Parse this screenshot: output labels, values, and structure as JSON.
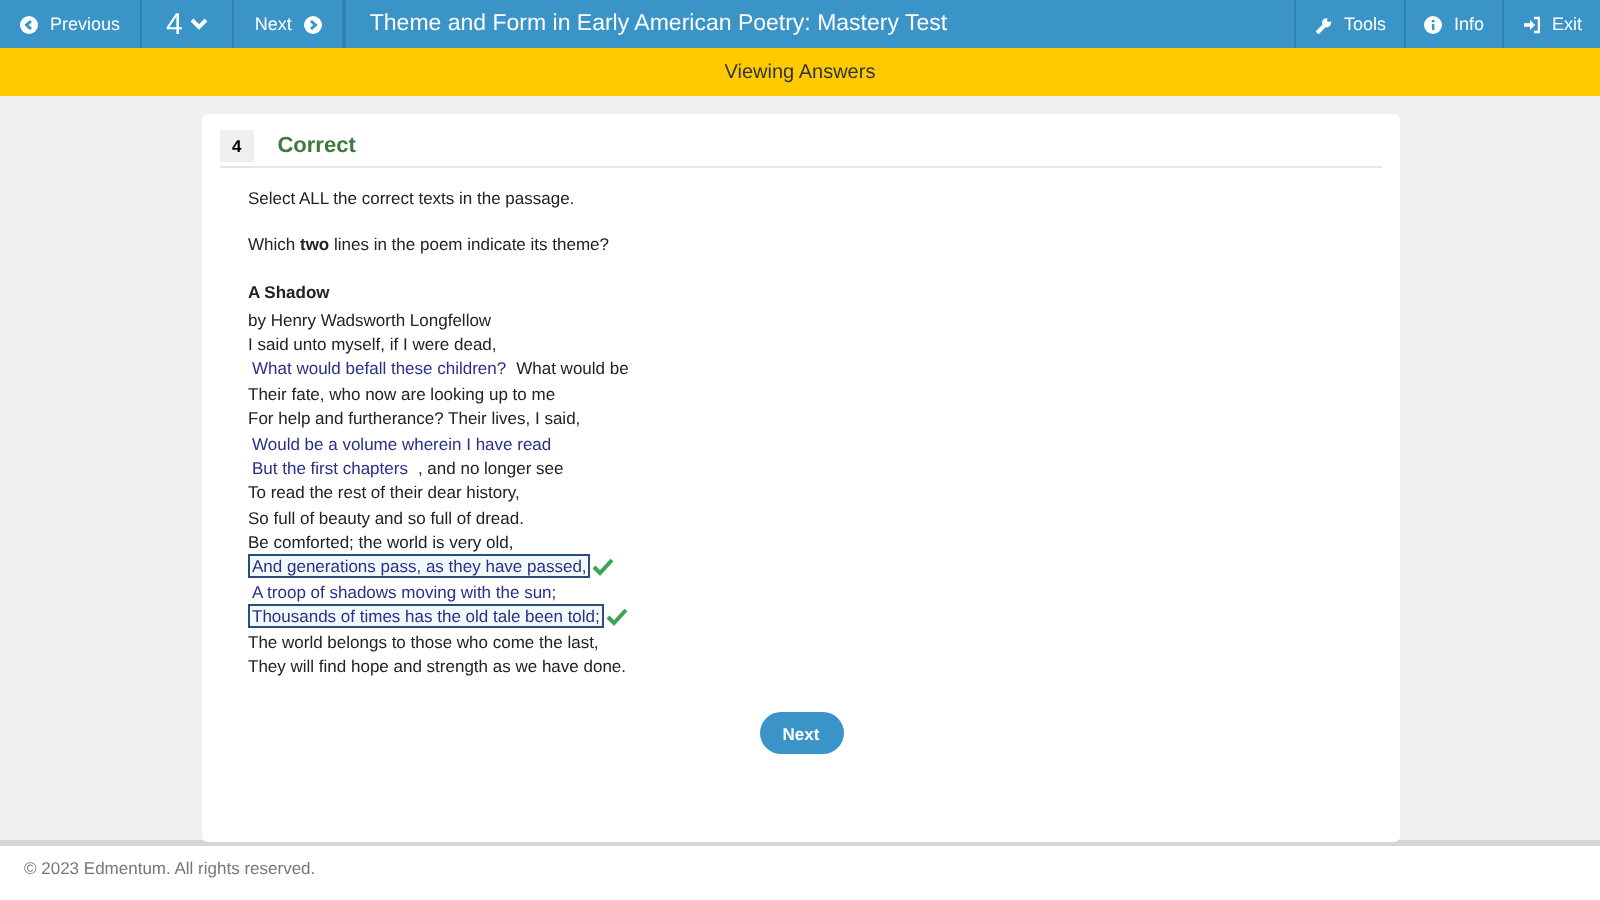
{
  "nav": {
    "previous": "Previous",
    "question_number": "4",
    "next": "Next",
    "title": "Theme and Form in Early American Poetry: Mastery Test",
    "tools": [
      {
        "kind": "tools",
        "label": "Tools"
      },
      {
        "kind": "info",
        "label": "Info"
      },
      {
        "kind": "exit",
        "label": "Exit"
      }
    ]
  },
  "banner": "Viewing Answers",
  "question": {
    "number": "4",
    "status": "Correct",
    "instruction": "Select ALL the correct texts in the passage.",
    "prompt": "Which **two** lines in the poem indicate its theme?",
    "poem_title": "A Shadow",
    "author": "by Henry Wadsworth Longfellow",
    "lines": [
      {
        "segments": [
          {
            "kind": "plain",
            "text": "I said unto myself, if I were dead,"
          }
        ]
      },
      {
        "segments": [
          {
            "kind": "option",
            "text": "What would befall these children?",
            "selected": false,
            "correct": false
          },
          {
            "kind": "plain",
            "text": "What would be"
          }
        ]
      },
      {
        "segments": [
          {
            "kind": "plain",
            "text": "Their fate, who now are looking up to me"
          }
        ]
      },
      {
        "segments": [
          {
            "kind": "plain",
            "text": "For help and furtherance? Their lives, I said,"
          }
        ]
      },
      {
        "segments": [
          {
            "kind": "option",
            "text": "Would be a volume wherein I have read",
            "selected": false,
            "correct": false
          }
        ]
      },
      {
        "segments": [
          {
            "kind": "option",
            "text": "But the first chapters",
            "selected": false,
            "correct": false
          },
          {
            "kind": "plain",
            "text": ", and no longer see"
          }
        ]
      },
      {
        "segments": [
          {
            "kind": "plain",
            "text": "To read the rest of their dear history,"
          }
        ]
      },
      {
        "segments": [
          {
            "kind": "plain",
            "text": "So full of beauty and so full of dread."
          }
        ]
      },
      {
        "segments": [
          {
            "kind": "plain",
            "text": "Be comforted; the world is very old,"
          }
        ]
      },
      {
        "segments": [
          {
            "kind": "option",
            "text": "And generations pass, as they have passed,",
            "selected": true,
            "correct": true
          }
        ]
      },
      {
        "segments": [
          {
            "kind": "option",
            "text": "A troop of shadows moving with the sun;",
            "selected": false,
            "correct": false
          }
        ]
      },
      {
        "segments": [
          {
            "kind": "option",
            "text": "Thousands of times has the old tale been told;",
            "selected": true,
            "correct": true
          }
        ]
      },
      {
        "segments": [
          {
            "kind": "plain",
            "text": "The world belongs to those who come the last,"
          }
        ]
      },
      {
        "segments": [
          {
            "kind": "plain",
            "text": "They will find hope and strength as we have done."
          }
        ]
      }
    ],
    "next_button": "Next"
  },
  "footer": "© 2023 Edmentum. All rights reserved."
}
